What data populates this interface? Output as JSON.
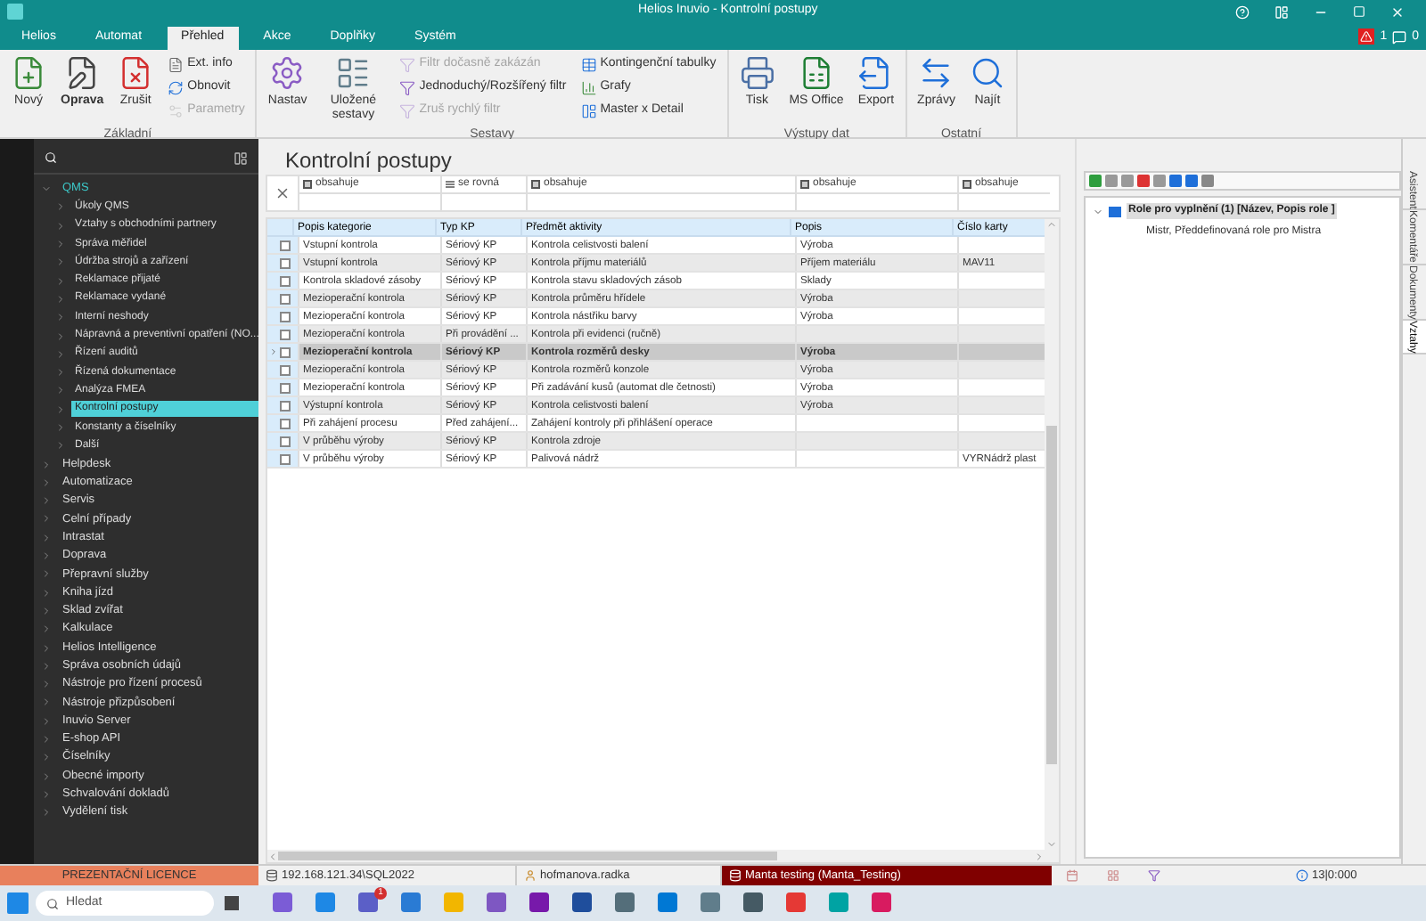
{
  "window": {
    "title": "Helios Inuvio - Kontrolní postupy",
    "alerts": "1",
    "messages": "0"
  },
  "menu_tabs": [
    {
      "label": "Helios",
      "selected": false
    },
    {
      "label": "Automat",
      "selected": false
    },
    {
      "label": "Přehled",
      "selected": true
    },
    {
      "label": "Akce",
      "selected": false
    },
    {
      "label": "Doplňky",
      "selected": false
    },
    {
      "label": "Systém",
      "selected": false
    }
  ],
  "ribbon": [
    {
      "label": "Základní",
      "items": [
        {
          "kind": "big",
          "label": "Nový",
          "bold": false
        },
        {
          "kind": "big",
          "label": "Oprava",
          "bold": true
        },
        {
          "kind": "big",
          "label": "Zrušit",
          "bold": false
        },
        {
          "kind": "stack",
          "items": [
            {
              "label": "Ext. info",
              "disabled": false
            },
            {
              "label": "Obnovit",
              "disabled": false
            },
            {
              "label": "Parametry",
              "disabled": true
            }
          ]
        }
      ]
    },
    {
      "label": "Sestavy",
      "items": [
        {
          "kind": "big",
          "label": "Nastav",
          "bold": false
        },
        {
          "kind": "big",
          "label": "Uložené sestavy",
          "bold": false
        },
        {
          "kind": "stack",
          "items": [
            {
              "label": "Filtr dočasně zakázán",
              "disabled": true
            },
            {
              "label": "Jednoduchý/Rozšířený filtr",
              "disabled": false
            },
            {
              "label": "Zruš rychlý filtr",
              "disabled": true
            }
          ]
        },
        {
          "kind": "stack",
          "items": [
            {
              "label": "Kontingenční tabulky",
              "disabled": false
            },
            {
              "label": "Grafy",
              "disabled": false
            },
            {
              "label": "Master x Detail",
              "disabled": false
            }
          ]
        }
      ]
    },
    {
      "label": "Výstupy dat",
      "items": [
        {
          "kind": "big",
          "label": "Tisk",
          "bold": false
        },
        {
          "kind": "big",
          "label": "MS Office",
          "bold": false
        },
        {
          "kind": "big",
          "label": "Export",
          "bold": false
        }
      ]
    },
    {
      "label": "Ostatní",
      "items": [
        {
          "kind": "big",
          "label": "Zprávy",
          "bold": false
        },
        {
          "kind": "big",
          "label": "Najít",
          "bold": false
        }
      ]
    }
  ],
  "sidebar": {
    "items": [
      {
        "label": "QMS",
        "expanded": true,
        "children": [
          {
            "label": "Úkoly QMS",
            "selected": false
          },
          {
            "label": "Vztahy s obchodními partnery",
            "selected": false
          },
          {
            "label": "Správa měřidel",
            "selected": false
          },
          {
            "label": "Údržba strojů a zařízení",
            "selected": false
          },
          {
            "label": "Reklamace přijaté",
            "selected": false
          },
          {
            "label": "Reklamace vydané",
            "selected": false
          },
          {
            "label": "Interní neshody",
            "selected": false
          },
          {
            "label": "Nápravná a preventivní opatření (NO...",
            "selected": false
          },
          {
            "label": "Řízení auditů",
            "selected": false
          },
          {
            "label": "Řízená dokumentace",
            "selected": false
          },
          {
            "label": "Analýza FMEA",
            "selected": false
          },
          {
            "label": "Kontrolní postupy",
            "selected": true
          },
          {
            "label": "Konstanty a číselníky",
            "selected": false
          },
          {
            "label": "Další",
            "selected": false
          }
        ]
      },
      {
        "label": "Helpdesk",
        "expanded": false
      },
      {
        "label": "Automatizace",
        "expanded": false
      },
      {
        "label": "Servis",
        "expanded": false
      },
      {
        "label": "Celní případy",
        "expanded": false
      },
      {
        "label": "Intrastat",
        "expanded": false
      },
      {
        "label": "Doprava",
        "expanded": false
      },
      {
        "label": "Přepravní služby",
        "expanded": false
      },
      {
        "label": "Kniha jízd",
        "expanded": false
      },
      {
        "label": "Sklad zvířat",
        "expanded": false
      },
      {
        "label": "Kalkulace",
        "expanded": false
      },
      {
        "label": "Helios Intelligence",
        "expanded": false
      },
      {
        "label": "Správa osobních údajů",
        "expanded": false
      },
      {
        "label": "Nástroje pro řízení procesů",
        "expanded": false
      },
      {
        "label": "Nástroje přizpůsobení",
        "expanded": false
      },
      {
        "label": "Inuvio Server",
        "expanded": false
      },
      {
        "label": "E-shop API",
        "expanded": false
      },
      {
        "label": "Číselníky",
        "expanded": false
      },
      {
        "label": "Obecné importy",
        "expanded": false
      },
      {
        "label": "Schvalování dokladů",
        "expanded": false
      },
      {
        "label": "Vydělení tisk",
        "expanded": false
      }
    ],
    "license": "PREZENTAČNÍ LICENCE"
  },
  "page_title": "Kontrolní postupy",
  "filters": [
    {
      "operator": "obsahuje",
      "kind": "contains"
    },
    {
      "operator": "se rovná",
      "kind": "equals"
    },
    {
      "operator": "obsahuje",
      "kind": "contains"
    },
    {
      "operator": "obsahuje",
      "kind": "contains"
    },
    {
      "operator": "obsahuje",
      "kind": "contains"
    }
  ],
  "table": {
    "columns": [
      "Popis kategorie",
      "Typ KP",
      "Předmět aktivity",
      "Popis",
      "Číslo karty"
    ],
    "rows": [
      {
        "cells": [
          "Vstupní kontrola",
          "Sériový KP",
          "Kontrola celistvosti balení",
          "Výroba",
          null
        ],
        "selected": false
      },
      {
        "cells": [
          "Vstupní kontrola",
          "Sériový KP",
          "Kontrola příjmu materiálů",
          "Příjem materiálu",
          "MAV11"
        ],
        "selected": false
      },
      {
        "cells": [
          "Kontrola skladové zásoby",
          "Sériový KP",
          "Kontrola stavu skladových zásob",
          "Sklady",
          null
        ],
        "selected": false
      },
      {
        "cells": [
          "Mezioperační kontrola",
          "Sériový KP",
          "Kontrola průměru hřídele",
          "Výroba",
          null
        ],
        "selected": false
      },
      {
        "cells": [
          "Mezioperační kontrola",
          "Sériový KP",
          "Kontrola nástřiku barvy",
          "Výroba",
          null
        ],
        "selected": false
      },
      {
        "cells": [
          "Mezioperační kontrola",
          "Při provádění ...",
          "Kontrola při evidenci (ručně)",
          null,
          null
        ],
        "selected": false
      },
      {
        "cells": [
          "Mezioperační kontrola",
          "Sériový KP",
          "Kontrola rozměrů desky",
          "Výroba",
          null
        ],
        "selected": true
      },
      {
        "cells": [
          "Mezioperační kontrola",
          "Sériový KP",
          "Kontrola rozměrů konzole",
          "Výroba",
          null
        ],
        "selected": false
      },
      {
        "cells": [
          "Mezioperační kontrola",
          "Sériový KP",
          "Při zadávání kusů  (automat dle četnosti)",
          "Výroba",
          null
        ],
        "selected": false
      },
      {
        "cells": [
          "Výstupní kontrola",
          "Sériový KP",
          "Kontrola celistvosti balení",
          "Výroba",
          null
        ],
        "selected": false
      },
      {
        "cells": [
          "Při zahájení procesu",
          "Před zahájení...",
          "Zahájení kontroly při přihlášení operace",
          null,
          null
        ],
        "selected": false
      },
      {
        "cells": [
          "V průběhu výroby",
          "Sériový KP",
          "Kontrola zdroje",
          null,
          null
        ],
        "selected": false
      },
      {
        "cells": [
          "V průběhu výroby",
          "Sériový KP",
          "Palivová nádrž",
          null,
          "VYRNádrž plast"
        ],
        "selected": false
      }
    ]
  },
  "relations": {
    "root": "Role pro vyplnění (1) [Název, Popis role ]",
    "children": [
      "Mistr, Předdefinovaná role pro Mistra"
    ]
  },
  "side_tabs": [
    {
      "label": "Asistent",
      "selected": false
    },
    {
      "label": "Komentáře",
      "selected": false
    },
    {
      "label": "Dokumenty",
      "selected": false
    },
    {
      "label": "Vztahy",
      "selected": true
    }
  ],
  "status_bar": {
    "server": "192.168.121.34\\SQL2022",
    "user": "hofmanova.radka",
    "database": "Manta testing (Manta_Testing)",
    "info": "13|0:000"
  },
  "taskbar": {
    "search_placeholder": "Hledat",
    "apps": [
      {
        "color": "#7b5cd6"
      },
      {
        "color": "#1e88e5"
      },
      {
        "color": "#5b5fc7",
        "badge": "1"
      },
      {
        "color": "#2a7bd4"
      },
      {
        "color": "#f2b600"
      },
      {
        "color": "#7e57c2"
      },
      {
        "color": "#7719aa"
      },
      {
        "color": "#1f4e9c"
      },
      {
        "color": "#546e7a"
      },
      {
        "color": "#0078d4"
      },
      {
        "color": "#607d8b"
      },
      {
        "color": "#455a64"
      },
      {
        "color": "#e53935"
      },
      {
        "color": "#00a3a3"
      },
      {
        "color": "#d81b60"
      }
    ]
  }
}
